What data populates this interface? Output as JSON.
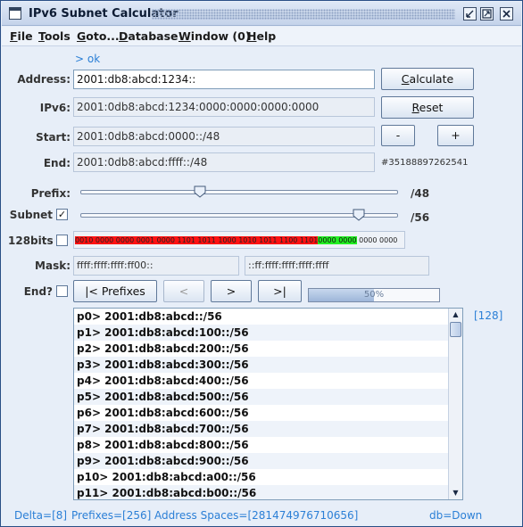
{
  "window": {
    "title": "IPv6 Subnet Calculator",
    "controls": [
      "minimize",
      "maximize",
      "close"
    ]
  },
  "menu": [
    {
      "label": "File",
      "mnemonic": "F",
      "rest": "ile"
    },
    {
      "label": "Tools",
      "mnemonic": "T",
      "rest": "ools"
    },
    {
      "label": "Goto...",
      "mnemonic": "G",
      "rest": "oto..."
    },
    {
      "label": "Database",
      "mnemonic": "D",
      "rest": "atabase"
    },
    {
      "label": "Window (0)",
      "mnemonic": "W",
      "rest": "indow (0)"
    },
    {
      "label": "Help",
      "mnemonic": "H",
      "rest": "elp"
    }
  ],
  "status_link": "> ok",
  "address": {
    "label": "Address:",
    "value": "2001:db8:abcd:1234::"
  },
  "ipv6": {
    "label": "IPv6:",
    "value": "2001:0db8:abcd:1234:0000:0000:0000:0000"
  },
  "start": {
    "label": "Start:",
    "value": "2001:0db8:abcd:0000::/48"
  },
  "end": {
    "label": "End:",
    "value": "2001:0db8:abcd:ffff::/48"
  },
  "end_count": "#35188897262541",
  "buttons": {
    "calculate": "Calculate",
    "calculate_mnemonic": "C",
    "calculate_rest": "alculate",
    "reset": "Reset",
    "reset_mnemonic": "R",
    "reset_rest": "eset",
    "minus": "-",
    "plus": "+",
    "prefixes": "|< Prefixes",
    "prev": "<",
    "next": ">",
    "last": ">|"
  },
  "prefix": {
    "label": "Prefix:",
    "value_text": "/48",
    "value": 48,
    "max": 128
  },
  "subnet": {
    "label": "Subnet",
    "checked": true,
    "check_glyph": "✓",
    "value_text": "/56",
    "value": 56,
    "max": 64
  },
  "bits128": {
    "label": "128bits",
    "checked": false
  },
  "bits": {
    "red": "0010 0000 0000 0001 0000 1101 1011 1000 1010 1011 1100 1101",
    "green": "0000 0000",
    "plain": "0000 0000"
  },
  "mask": {
    "label": "Mask:",
    "value1": "ffff:ffff:ffff:ff00::",
    "value2": "::ff:ffff:ffff:ffff:ffff"
  },
  "end_check": {
    "label": "End?",
    "checked": false
  },
  "progress": {
    "text": "50%",
    "value": 0.5
  },
  "list_count": "[128]",
  "prefix_list": [
    "p0> 2001:db8:abcd::/56",
    "p1> 2001:db8:abcd:100::/56",
    "p2> 2001:db8:abcd:200::/56",
    "p3> 2001:db8:abcd:300::/56",
    "p4> 2001:db8:abcd:400::/56",
    "p5> 2001:db8:abcd:500::/56",
    "p6> 2001:db8:abcd:600::/56",
    "p7> 2001:db8:abcd:700::/56",
    "p8> 2001:db8:abcd:800::/56",
    "p9> 2001:db8:abcd:900::/56",
    "p10> 2001:db8:abcd:a00::/56",
    "p11> 2001:db8:abcd:b00::/56"
  ],
  "status": {
    "delta": "Delta=[8]",
    "prefixes": "Prefixes=[256]",
    "address_spaces": "Address Spaces=[281474976710656]",
    "db": "db=Down"
  },
  "icons": {
    "minimize": "minimize-icon",
    "maximize": "maximize-icon",
    "close": "close-icon",
    "slider": "slider-thumb-icon",
    "scroll_up": "scroll-up-icon",
    "scroll_down": "scroll-down-icon"
  },
  "colors": {
    "bits_network": "#ff1111",
    "bits_subnet": "#22ee22",
    "link": "#2b7fd6"
  }
}
